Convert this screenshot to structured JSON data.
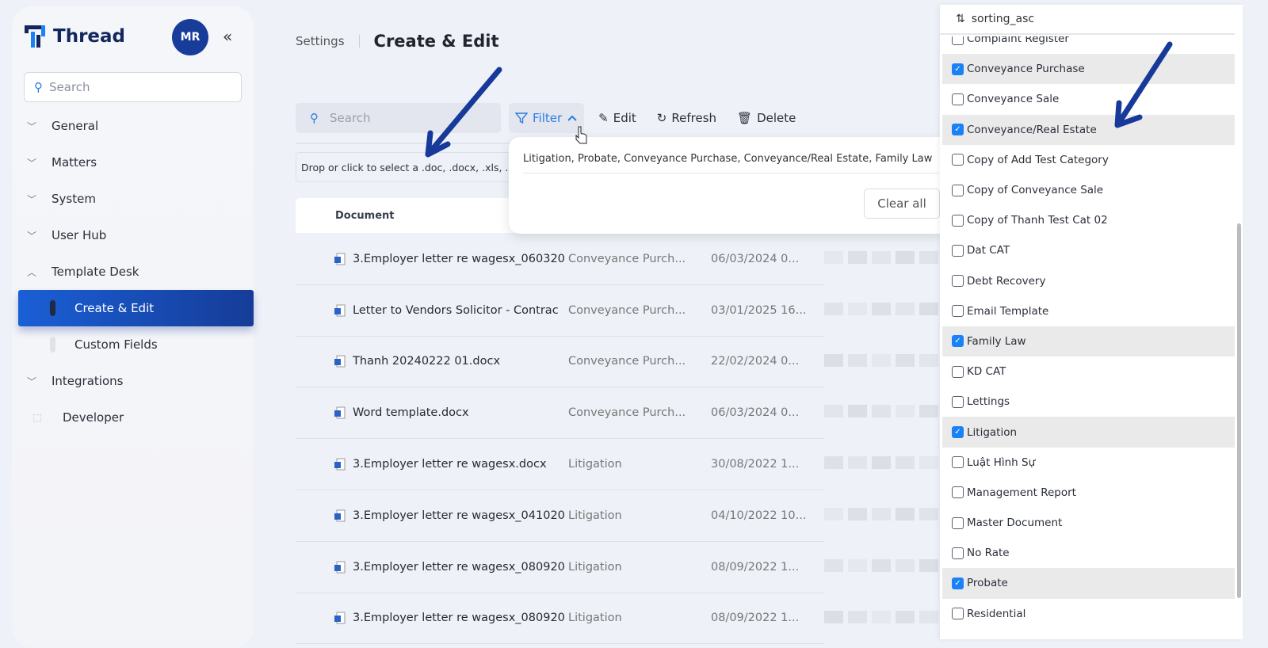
{
  "app": {
    "name": "Thread",
    "avatar": "MR",
    "collapse_icon": "double-chevron-left-icon"
  },
  "sidebar": {
    "search_placeholder": "Search",
    "items": [
      {
        "label": "General",
        "expanded": false
      },
      {
        "label": "Matters",
        "expanded": false
      },
      {
        "label": "System",
        "expanded": false
      },
      {
        "label": "User Hub",
        "expanded": false
      },
      {
        "label": "Template Desk",
        "expanded": true
      },
      {
        "label": "Create & Edit",
        "sub": true,
        "active": true
      },
      {
        "label": "Custom Fields",
        "sub": true
      },
      {
        "label": "Integrations",
        "expanded": false
      },
      {
        "label": "Developer",
        "icon": "developer-icon"
      }
    ]
  },
  "header": {
    "breadcrumb": "Settings",
    "title": "Create & Edit"
  },
  "toolbar": {
    "search_placeholder": "Search",
    "filter": "Filter",
    "edit": "Edit",
    "refresh": "Refresh",
    "delete": "Delete"
  },
  "upload": {
    "text": "Drop or click to select a .doc, .docx, .xls, ..."
  },
  "table": {
    "header": "Document",
    "rows": [
      {
        "doc": "3.Employer letter re wagesx_060320",
        "cat": "Conveyance Purch...",
        "date": "06/03/2024 0..."
      },
      {
        "doc": "Letter to Vendors Solicitor - Contrac",
        "cat": "Conveyance Purch...",
        "date": "03/01/2025 16..."
      },
      {
        "doc": "Thanh 20240222 01.docx",
        "cat": "Conveyance Purch...",
        "date": "22/02/2024 0..."
      },
      {
        "doc": "Word template.docx",
        "cat": "Conveyance Purch...",
        "date": "06/03/2024 0..."
      },
      {
        "doc": "3.Employer letter re wagesx.docx",
        "cat": "Litigation",
        "date": "30/08/2022 1..."
      },
      {
        "doc": "3.Employer letter re wagesx_041020",
        "cat": "Litigation",
        "date": "04/10/2022 10..."
      },
      {
        "doc": "3.Employer letter re wagesx_080920",
        "cat": "Litigation",
        "date": "08/09/2022 1..."
      },
      {
        "doc": "3.Employer letter re wagesx_080920",
        "cat": "Litigation",
        "date": "08/09/2022 1..."
      }
    ]
  },
  "filter_popover": {
    "value": "Litigation, Probate, Conveyance Purchase, Conveyance/Real Estate, Family Law",
    "clear_all": "Clear all"
  },
  "dropdown": {
    "sort_label": "sorting_asc",
    "options": [
      {
        "label": "Complaint Register",
        "checked": false
      },
      {
        "label": "Conveyance Purchase",
        "checked": true
      },
      {
        "label": "Conveyance Sale",
        "checked": false
      },
      {
        "label": "Conveyance/Real Estate",
        "checked": true
      },
      {
        "label": "Copy of Add Test Category",
        "checked": false
      },
      {
        "label": "Copy of Conveyance Sale",
        "checked": false
      },
      {
        "label": "Copy of Thanh Test Cat 02",
        "checked": false
      },
      {
        "label": "Dat CAT",
        "checked": false
      },
      {
        "label": "Debt Recovery",
        "checked": false
      },
      {
        "label": "Email Template",
        "checked": false
      },
      {
        "label": "Family Law",
        "checked": true
      },
      {
        "label": "KD CAT",
        "checked": false
      },
      {
        "label": "Lettings",
        "checked": false
      },
      {
        "label": "Litigation",
        "checked": true
      },
      {
        "label": "Luật Hình Sự",
        "checked": false
      },
      {
        "label": "Management Report",
        "checked": false
      },
      {
        "label": "Master Document",
        "checked": false
      },
      {
        "label": "No Rate",
        "checked": false
      },
      {
        "label": "Probate",
        "checked": true
      },
      {
        "label": "Residential",
        "checked": false
      }
    ]
  },
  "colors": {
    "accent": "#1a82f5",
    "brand": "#173c9a",
    "active_nav": "#1a5fd6",
    "annotation_arrow": "#173a9a"
  }
}
